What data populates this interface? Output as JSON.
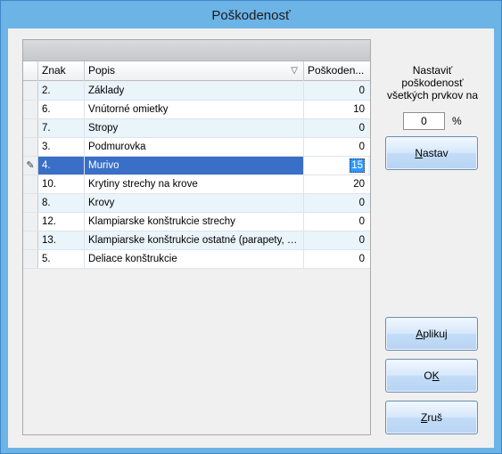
{
  "window": {
    "title": "Poškodenosť"
  },
  "grid": {
    "columns": [
      {
        "label": "Znak"
      },
      {
        "label": "Popis"
      },
      {
        "label": "Poškoden..."
      }
    ],
    "rows": [
      {
        "znak": "2.",
        "popis": "Základy",
        "value": "0"
      },
      {
        "znak": "6.",
        "popis": "Vnútorné omietky",
        "value": "10"
      },
      {
        "znak": "7.",
        "popis": "Stropy",
        "value": "0"
      },
      {
        "znak": "3.",
        "popis": "Podmurovka",
        "value": "0"
      },
      {
        "znak": "4.",
        "popis": "Murivo",
        "value": "15"
      },
      {
        "znak": "10.",
        "popis": "Krytiny strechy na krove",
        "value": "20"
      },
      {
        "znak": "8.",
        "popis": "Krovy",
        "value": "0"
      },
      {
        "znak": "12.",
        "popis": "Klampiarske konštrukcie strechy",
        "value": "0"
      },
      {
        "znak": "13.",
        "popis": "Klampiarske konštrukcie ostatné (parapety, ma...",
        "value": "0"
      },
      {
        "znak": "5.",
        "popis": "Deliace konštrukcie",
        "value": "0"
      }
    ],
    "selected_row_index": 4,
    "edit_indicator": "✎"
  },
  "side": {
    "label": "Nastaviť poškodenosť všetkých prvkov na",
    "percent_value": "0",
    "percent_sign": "%",
    "set_button": {
      "prefix": "",
      "mnemonic": "N",
      "suffix": "astav"
    }
  },
  "buttons": {
    "apply": {
      "prefix": "",
      "mnemonic": "A",
      "suffix": "plikuj"
    },
    "ok": {
      "prefix": "O",
      "mnemonic": "K",
      "suffix": ""
    },
    "cancel": {
      "prefix": "",
      "mnemonic": "Z",
      "suffix": "ruš"
    }
  }
}
